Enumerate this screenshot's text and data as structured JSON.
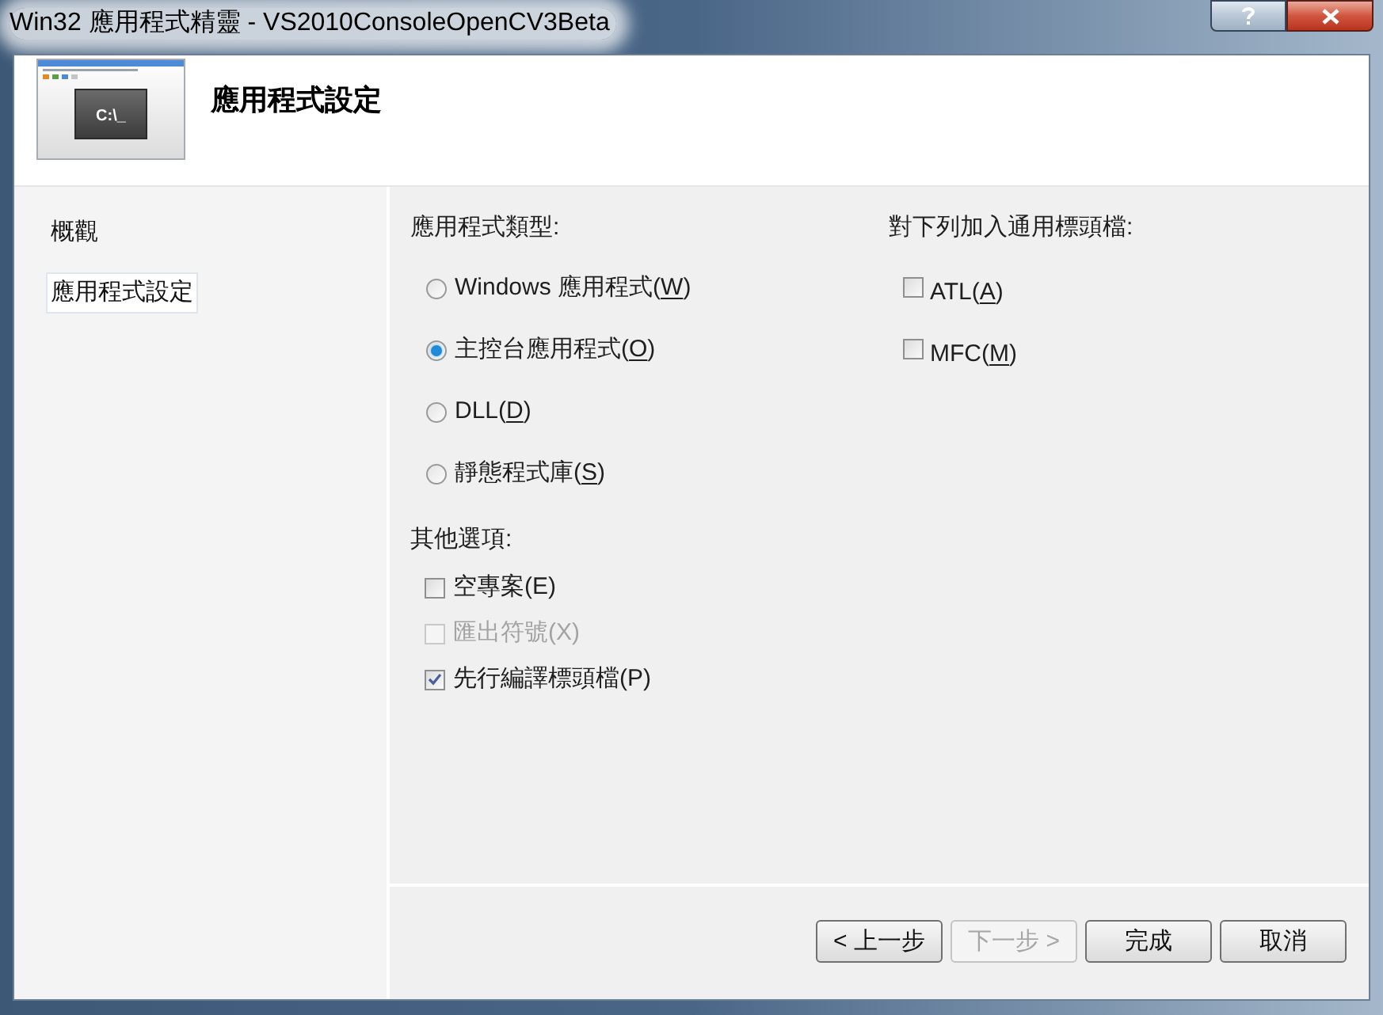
{
  "window": {
    "title": "Win32 應用程式精靈 - VS2010ConsoleOpenCV3Beta",
    "caption_buttons": [
      {
        "kind": "help"
      },
      {
        "kind": "close"
      }
    ]
  },
  "header": {
    "title": "應用程式設定",
    "preview_text": "C:\\_"
  },
  "sidebar": {
    "items": [
      {
        "label": "概觀",
        "selected": false
      },
      {
        "label": "應用程式設定",
        "selected": true
      }
    ]
  },
  "application_type": {
    "heading": "應用程式類型:",
    "options": [
      {
        "label": [
          "Windows 應用程式(",
          "W",
          ")"
        ],
        "selected": false
      },
      {
        "label": [
          "主控台應用程式(",
          "O",
          ")"
        ],
        "selected": true
      },
      {
        "label": [
          "DLL(",
          "D",
          ")"
        ],
        "selected": false
      },
      {
        "label": [
          "靜態程式庫(",
          "S",
          ")"
        ],
        "selected": false
      }
    ]
  },
  "additional_options": {
    "heading": "其他選項:",
    "options": [
      {
        "label": [
          "空專案(E)"
        ],
        "checked": false,
        "disabled": false
      },
      {
        "label": [
          "匯出符號(X)"
        ],
        "checked": false,
        "disabled": true
      },
      {
        "label": [
          "先行編譯標頭檔(P)"
        ],
        "checked": true,
        "disabled": false
      }
    ]
  },
  "common_headers": {
    "heading": "對下列加入通用標頭檔:",
    "options": [
      {
        "label": [
          "ATL(",
          "A",
          ")"
        ],
        "checked": false
      },
      {
        "label": [
          "MFC(",
          "M",
          ")"
        ],
        "checked": false
      }
    ]
  },
  "buttons": [
    {
      "label": "< 上一步",
      "disabled": false
    },
    {
      "label": "下一步 >",
      "disabled": true
    },
    {
      "label": "完成",
      "disabled": false
    },
    {
      "label": "取消",
      "disabled": false
    }
  ]
}
